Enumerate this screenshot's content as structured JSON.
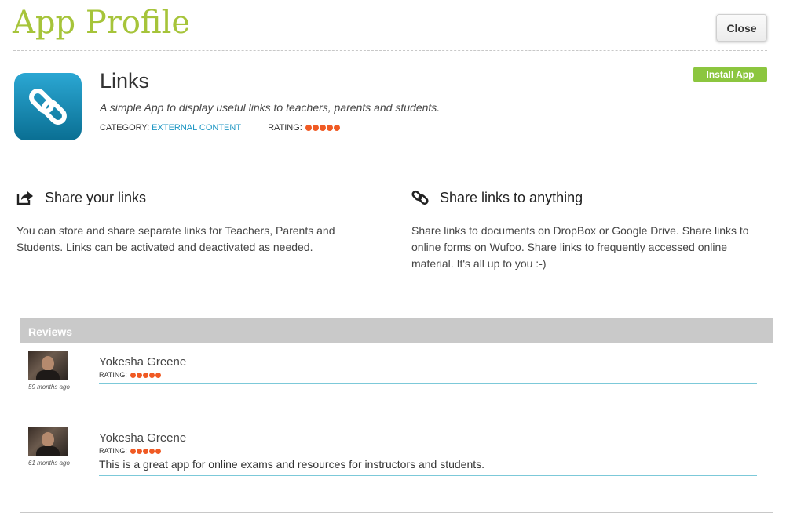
{
  "header": {
    "title": "App Profile",
    "close_label": "Close"
  },
  "app": {
    "name": "Links",
    "description": "A simple App to display useful links to teachers, parents and students.",
    "category_label": "CATEGORY:",
    "category_value": "EXTERNAL CONTENT",
    "rating_label": "RATING:",
    "rating": 5,
    "install_label": "Install App",
    "icon": "chain-link-icon",
    "icon_colors": [
      "#2ba7d3",
      "#0a6f93"
    ]
  },
  "features": [
    {
      "icon": "share-icon",
      "title": "Share your links",
      "text": "You can store and share separate links for Teachers, Parents and Students. Links can be activated and deactivated as needed."
    },
    {
      "icon": "link-icon",
      "title": "Share links to anything",
      "text": "Share links to documents on DropBox or Google Drive. Share links to online forms on Wufoo. Share links to frequently accessed online material. It's all up to you :-)"
    }
  ],
  "reviews": {
    "title": "Reviews",
    "items": [
      {
        "name": "Yokesha Greene",
        "time": "59 months ago",
        "rating_label": "RATING:",
        "rating": 5,
        "text": ""
      },
      {
        "name": "Yokesha Greene",
        "time": "61 months ago",
        "rating_label": "RATING:",
        "rating": 5,
        "text": "This is a great app for online exams and resources for instructors and students."
      }
    ]
  },
  "colors": {
    "title": "#a6c43a",
    "install": "#8cc63f",
    "rating_dot": "#f05a24",
    "category_link": "#1d96c3"
  }
}
